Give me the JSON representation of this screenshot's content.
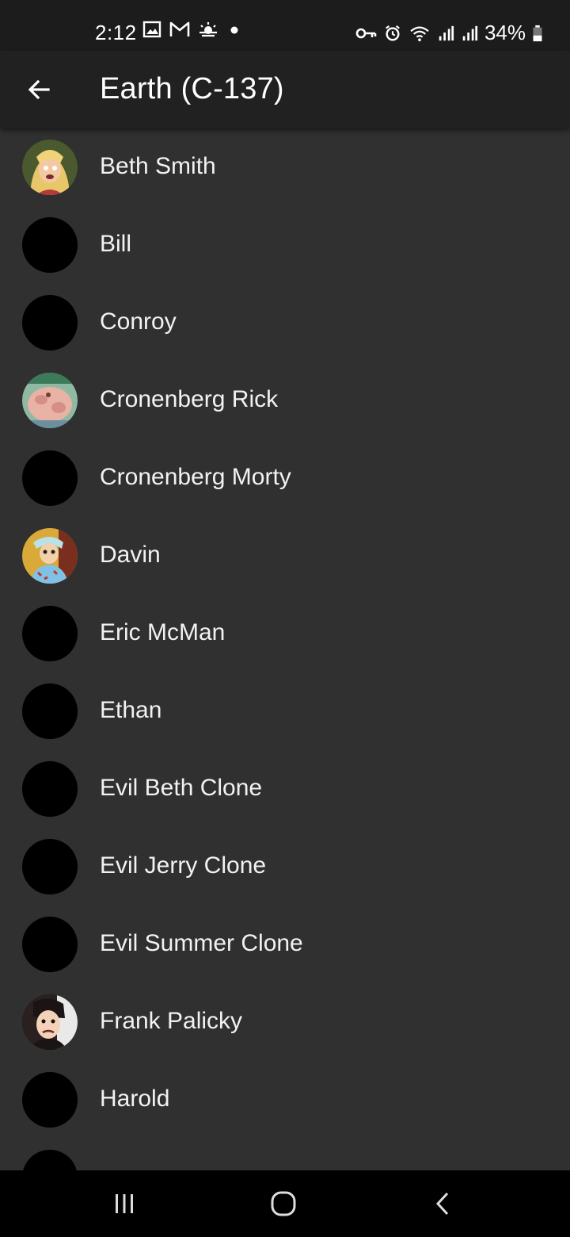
{
  "status_bar": {
    "time": "2:12",
    "battery_percent": "34%",
    "icons_left": [
      "image-icon",
      "gmail-icon",
      "weather-icon",
      "dot-icon"
    ],
    "icons_right": [
      "vpn-key-icon",
      "alarm-icon",
      "wifi-icon",
      "signal-icon",
      "signal-icon",
      "battery-icon"
    ]
  },
  "app_bar": {
    "title": "Earth (C-137)",
    "back_icon": "arrow-back-icon"
  },
  "characters": [
    {
      "name": "Beth Smith",
      "avatar": "photo"
    },
    {
      "name": "Bill",
      "avatar": "placeholder"
    },
    {
      "name": "Conroy",
      "avatar": "placeholder"
    },
    {
      "name": "Cronenberg Rick",
      "avatar": "photo"
    },
    {
      "name": "Cronenberg Morty",
      "avatar": "placeholder"
    },
    {
      "name": "Davin",
      "avatar": "photo"
    },
    {
      "name": "Eric McMan",
      "avatar": "placeholder"
    },
    {
      "name": "Ethan",
      "avatar": "placeholder"
    },
    {
      "name": "Evil Beth Clone",
      "avatar": "placeholder"
    },
    {
      "name": "Evil Jerry Clone",
      "avatar": "placeholder"
    },
    {
      "name": "Evil Summer Clone",
      "avatar": "placeholder"
    },
    {
      "name": "Frank Palicky",
      "avatar": "photo"
    },
    {
      "name": "Harold",
      "avatar": "placeholder"
    },
    {
      "name": "",
      "avatar": "placeholder"
    }
  ],
  "nav_bar": {
    "buttons": [
      "recent-apps-icon",
      "home-icon",
      "back-icon"
    ]
  },
  "colors": {
    "background": "#303030",
    "app_bar": "#212121",
    "status_bar": "#1c1c1c",
    "text": "#ffffff"
  }
}
